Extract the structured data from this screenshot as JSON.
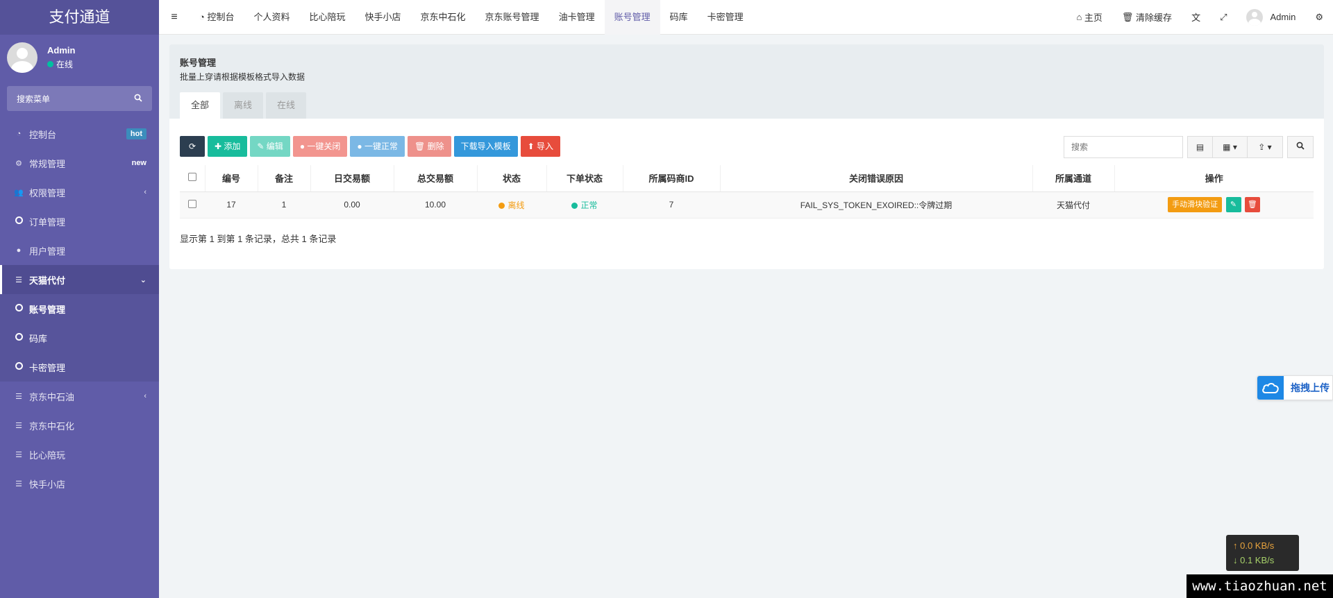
{
  "brand": "支付通道",
  "user": {
    "name": "Admin",
    "status": "在线"
  },
  "sidebar": {
    "search_label": "搜索菜单",
    "items": [
      {
        "label": "控制台",
        "icon": "dashboard-icon",
        "badge": "hot"
      },
      {
        "label": "常规管理",
        "icon": "cogs-icon",
        "badge": "new"
      },
      {
        "label": "权限管理",
        "icon": "users-icon"
      },
      {
        "label": "订单管理",
        "icon": "circle-icon"
      },
      {
        "label": "用户管理",
        "icon": "user-icon"
      },
      {
        "label": "天猫代付",
        "icon": "list-icon"
      },
      {
        "label": "账号管理",
        "icon": "circle-icon"
      },
      {
        "label": "码库",
        "icon": "circle-icon"
      },
      {
        "label": "卡密管理",
        "icon": "circle-icon"
      },
      {
        "label": "京东中石油",
        "icon": "list-icon"
      },
      {
        "label": "京东中石化",
        "icon": "list-icon"
      },
      {
        "label": "比心陪玩",
        "icon": "list-icon"
      },
      {
        "label": "快手小店",
        "icon": "list-icon"
      }
    ]
  },
  "topbar": {
    "tabs": [
      "控制台",
      "个人资料",
      "比心陪玩",
      "快手小店",
      "京东中石化",
      "京东账号管理",
      "油卡管理",
      "账号管理",
      "码库",
      "卡密管理"
    ],
    "home": "主页",
    "clear_cache": "清除缓存",
    "admin": "Admin"
  },
  "panel": {
    "title": "账号管理",
    "subtitle": "批量上穿请根据模板格式导入数据",
    "tabs": [
      "全部",
      "离线",
      "在线"
    ]
  },
  "toolbar": {
    "add": "添加",
    "edit": "编辑",
    "close_all": "一键关闭",
    "normal_all": "一键正常",
    "delete": "删除",
    "download_template": "下载导入模板",
    "import": "导入",
    "search_placeholder": "搜索"
  },
  "table": {
    "headers": [
      "编号",
      "备注",
      "日交易额",
      "总交易额",
      "状态",
      "下单状态",
      "所属码商ID",
      "关闭错误原因",
      "所属通道",
      "操作"
    ],
    "rows": [
      {
        "id": "17",
        "note": "1",
        "day_amount": "0.00",
        "total_amount": "10.00",
        "status": "离线",
        "order_status": "正常",
        "merchant_id": "7",
        "error_reason": "FAIL_SYS_TOKEN_EXOIRED::令牌过期",
        "channel": "天猫代付",
        "action_label": "手动滑块验证"
      }
    ]
  },
  "summary": "显示第 1 到第 1 条记录，总共 1 条记录",
  "upload_widget": "拖拽上传",
  "speed": {
    "up": "0.0 KB/s",
    "down": "0.1 KB/s"
  },
  "watermark": "www.tiaozhuan.net",
  "colors": {
    "sidebar": "#605ca8",
    "accent": "#18bc9c",
    "danger": "#e74c3c",
    "warning": "#f39c12",
    "primary": "#3498db"
  }
}
